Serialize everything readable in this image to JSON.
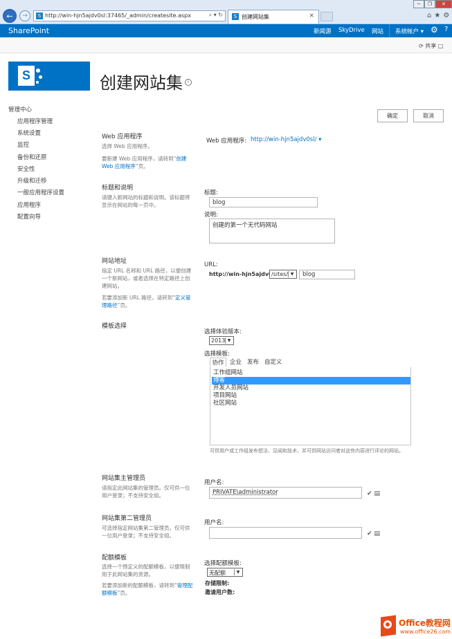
{
  "browser": {
    "url": "http://win-hjn5ajdv0sl:37465/_admin/createsite.aspx",
    "url_tools": "⌕ ▾ ↻",
    "tab_title": "创建网站集",
    "tab_close": "×",
    "window_buttons": [
      "─",
      "❐",
      "✕"
    ]
  },
  "suite": {
    "brand": "SharePoint",
    "links": [
      "新闻源",
      "SkyDrive",
      "网站"
    ],
    "account": "系统帐户 ▾",
    "gear": "⚙",
    "help": "?"
  },
  "ribbon": {
    "share": "共享"
  },
  "page": {
    "title": "创建网站集",
    "info": "i"
  },
  "nav": {
    "root": "管理中心",
    "items": [
      "应用程序管理",
      "系统设置",
      "监控",
      "备份和还原",
      "安全性",
      "升级和迁移",
      "一般应用程序设置",
      "应用程序",
      "配置向导"
    ]
  },
  "buttons": {
    "ok": "确定",
    "cancel": "取消"
  },
  "webapp": {
    "header": "Web 应用程序",
    "desc1": "选择 Web 应用程序。",
    "desc2": "要新建 Web 应用程序，请转到“",
    "desc2_link": "创建 Web 应用程序",
    "desc2_end": "”页。",
    "label": "Web 应用程序:",
    "value": "http://win-hjn5ajdv0sl/ ▾"
  },
  "title_desc": {
    "header": "标题和说明",
    "desc": "请键入新网站的标题和说明。该标题将显示在网站的每一页中。",
    "title_label": "标题:",
    "title_value": "blog",
    "desc_label": "说明:",
    "desc_value": "创建的第一个无代码网站"
  },
  "site_address": {
    "header": "网站地址",
    "desc1": "指定 URL 名称和 URL 路径，以便创建一个新网站，或者选择在特定路径上创建网站。",
    "desc2": "若要添加新 URL 路径，请转到“",
    "desc2_link": "定义管理路径",
    "desc2_end": "”页。",
    "url_label": "URL:",
    "prefix": "http://win-hjn5ajdv0sl",
    "path": "/sites/",
    "name": "blog"
  },
  "template": {
    "header": "模板选择",
    "version_label": "选择体验版本:",
    "version": "2013",
    "select_label": "选择模板:",
    "tabs": [
      "协作",
      "企业",
      "发布",
      "自定义"
    ],
    "items": [
      "工作组网站",
      "博客",
      "开发人员网站",
      "项目网站",
      "社区网站"
    ],
    "selected_index": 1,
    "help": "可供用户或工作组发布想法、见闻和技术，并可供网站访问者对这些内容进行评论的网站。"
  },
  "primary_admin": {
    "header": "网站集主管理员",
    "desc": "请指定此网站集的管理员。仅可供一位用户登录；不支持安全组。",
    "label": "用户名:",
    "value": "PRIVATE\\administrator"
  },
  "secondary_admin": {
    "header": "网站集第二管理员",
    "desc": "可选择指定网站集第二管理员。仅可供一位用户登录；不支持安全组。",
    "label": "用户名:",
    "value": ""
  },
  "quota": {
    "header": "配额模板",
    "desc1": "选择一个预定义的配额模板，以便限制用于此网站集的资源。",
    "desc2": "若要添加新的配额模板，请转到“",
    "desc2_link": "管理配额模板",
    "desc2_end": "”页。",
    "select_label": "选择配额模板:",
    "select_value": "无配额",
    "storage_label": "存储限制:",
    "invite_label": "邀请用户数:"
  },
  "watermark": {
    "line1": "Office教程网",
    "line2": "www.office26.com"
  }
}
